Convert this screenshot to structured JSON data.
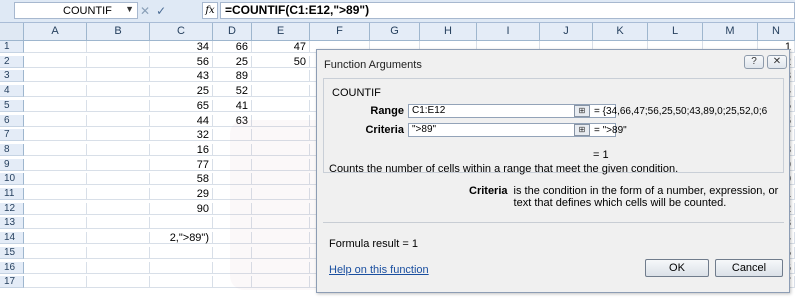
{
  "formula_bar": {
    "name_box": "COUNTIF",
    "cancel_glyph": "✕",
    "enter_glyph": "✓",
    "fx_label": "fx",
    "formula": "=COUNTIF(C1:E12,\">89\")"
  },
  "columns": [
    "A",
    "B",
    "C",
    "D",
    "E",
    "F",
    "G",
    "H",
    "I",
    "J",
    "K",
    "L",
    "M",
    "N"
  ],
  "rows": [
    {
      "n": "1",
      "c": "34",
      "d": "66",
      "e": "47"
    },
    {
      "n": "2",
      "c": "56",
      "d": "25",
      "e": "50"
    },
    {
      "n": "3",
      "c": "43",
      "d": "89",
      "e": ""
    },
    {
      "n": "4",
      "c": "25",
      "d": "52",
      "e": ""
    },
    {
      "n": "5",
      "c": "65",
      "d": "41",
      "e": ""
    },
    {
      "n": "6",
      "c": "44",
      "d": "63",
      "e": ""
    },
    {
      "n": "7",
      "c": "32",
      "d": "",
      "e": ""
    },
    {
      "n": "8",
      "c": "16",
      "d": "",
      "e": ""
    },
    {
      "n": "9",
      "c": "77",
      "d": "",
      "e": ""
    },
    {
      "n": "10",
      "c": "58",
      "d": "",
      "e": ""
    },
    {
      "n": "11",
      "c": "29",
      "d": "",
      "e": ""
    },
    {
      "n": "12",
      "c": "90",
      "d": "",
      "e": ""
    },
    {
      "n": "13",
      "c": "",
      "d": "",
      "e": ""
    },
    {
      "n": "14",
      "c": "2,\">89\")",
      "d": "",
      "e": ""
    },
    {
      "n": "15",
      "c": "",
      "d": "",
      "e": ""
    },
    {
      "n": "16",
      "c": "",
      "d": "",
      "e": ""
    },
    {
      "n": "17",
      "c": "",
      "d": "",
      "e": ""
    }
  ],
  "dialog": {
    "title": "Function Arguments",
    "help_glyph": "?",
    "close_glyph": "✕",
    "function_name": "COUNTIF",
    "range_label": "Range",
    "range_value": "C1:E12",
    "range_result": "=  {34,66,47;56,25,50;43,89,0;25,52,0;6",
    "criteria_label": "Criteria",
    "criteria_value": "\">89\"",
    "criteria_result": "=  \">89\"",
    "ref_button_glyph": "⊞",
    "result_eq": "=  1",
    "description": "Counts the number of cells within a range that meet the given condition.",
    "criteria_desc_term": "Criteria",
    "criteria_desc_text": "is the condition in the form of a number, expression, or text that defines which cells will be counted.",
    "formula_result": "Formula result =   1",
    "help_link": "Help on this function",
    "ok_label": "OK",
    "cancel_label": "Cancel"
  }
}
